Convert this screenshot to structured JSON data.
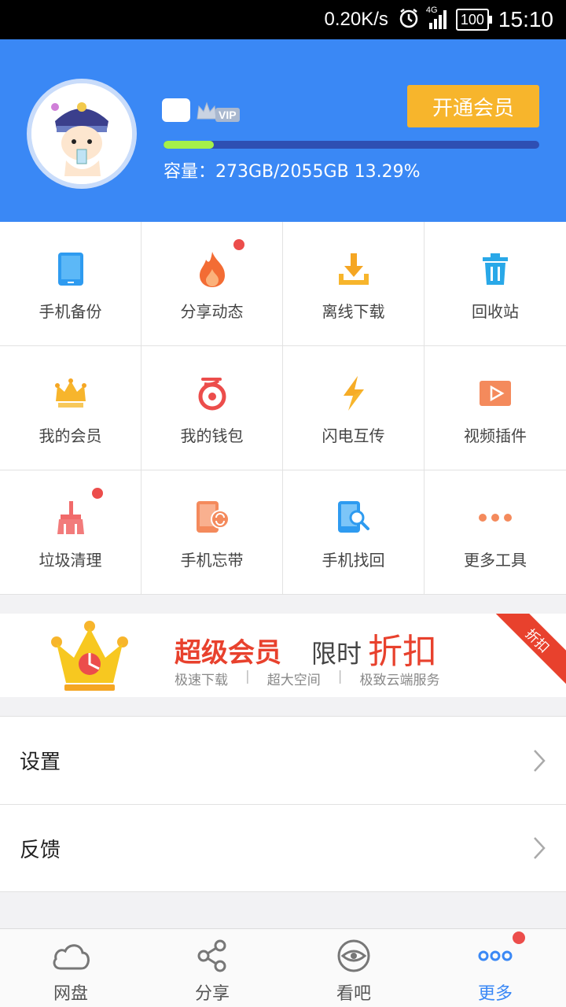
{
  "status_bar": {
    "speed": "0.20K/s",
    "network": "4G",
    "battery": "100",
    "time": "15:10"
  },
  "header": {
    "vip_label": "VIP",
    "open_vip_button": "开通会员",
    "capacity_text": "容量：273GB/2055GB 13.29%",
    "storage_used_fraction": 0.1329,
    "colors": {
      "background": "#3a88f5",
      "button": "#f7b52c",
      "progress_fill": "#a5f04a",
      "progress_track": "#2e4fb3"
    }
  },
  "grid": [
    {
      "label": "手机备份",
      "icon": "phone-backup-icon",
      "badge": false
    },
    {
      "label": "分享动态",
      "icon": "flame-icon",
      "badge": true
    },
    {
      "label": "离线下载",
      "icon": "download-icon",
      "badge": false
    },
    {
      "label": "回收站",
      "icon": "trash-icon",
      "badge": false
    },
    {
      "label": "我的会员",
      "icon": "crown-icon",
      "badge": false
    },
    {
      "label": "我的钱包",
      "icon": "wallet-icon",
      "badge": false
    },
    {
      "label": "闪电互传",
      "icon": "lightning-icon",
      "badge": false
    },
    {
      "label": "视频插件",
      "icon": "video-play-icon",
      "badge": false
    },
    {
      "label": "垃圾清理",
      "icon": "broom-icon",
      "badge": true
    },
    {
      "label": "手机忘带",
      "icon": "phone-sync-icon",
      "badge": false
    },
    {
      "label": "手机找回",
      "icon": "phone-search-icon",
      "badge": false
    },
    {
      "label": "更多工具",
      "icon": "more-dots-icon",
      "badge": false
    }
  ],
  "banner": {
    "title": "超级会员",
    "subtitle_prefix": "限时",
    "subtitle_highlight": "折扣",
    "features": [
      "极速下载",
      "超大空间",
      "极致云端服务"
    ],
    "corner_tag": "折扣"
  },
  "list": [
    {
      "label": "设置"
    },
    {
      "label": "反馈"
    }
  ],
  "bottom_nav": [
    {
      "label": "网盘",
      "icon": "cloud-icon",
      "active": false
    },
    {
      "label": "分享",
      "icon": "share-icon",
      "active": false
    },
    {
      "label": "看吧",
      "icon": "eye-icon",
      "active": false
    },
    {
      "label": "更多",
      "icon": "more-icon",
      "active": true
    }
  ]
}
